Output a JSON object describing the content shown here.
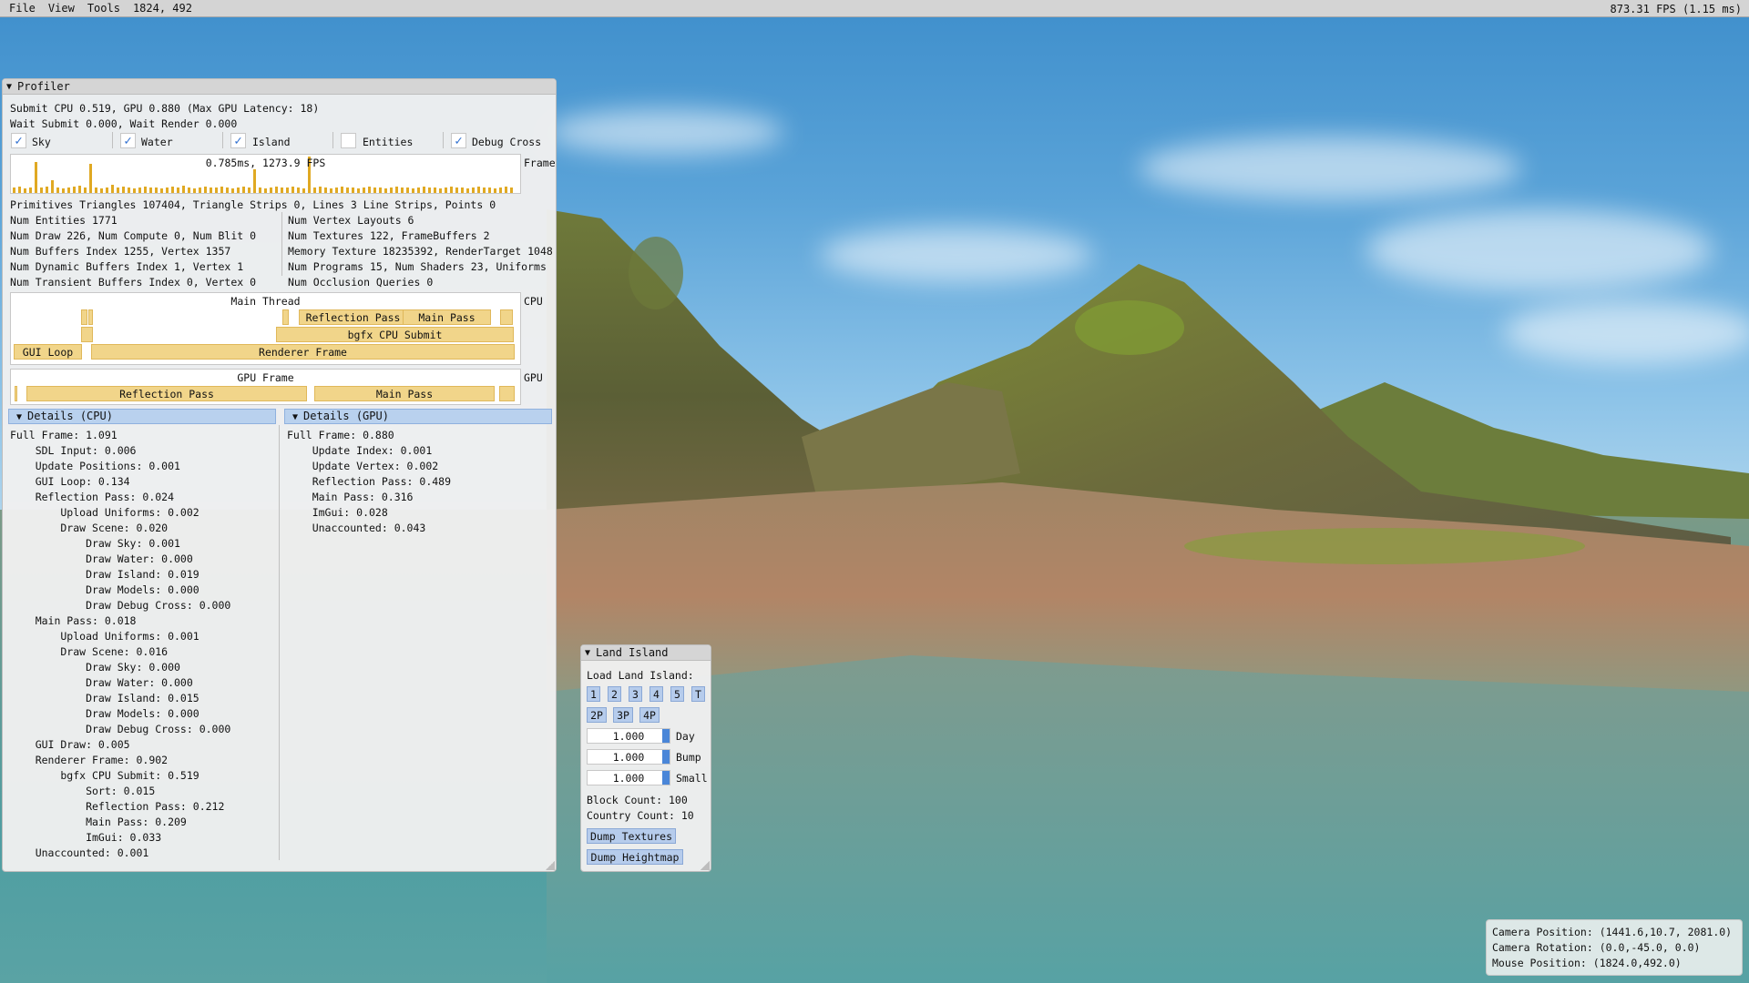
{
  "menubar": {
    "items": [
      "File",
      "View",
      "Tools"
    ],
    "mouse_readout": "1824, 492",
    "fps": "873.31 FPS (1.15 ms)"
  },
  "profiler": {
    "title": "Profiler",
    "submit_line": "Submit CPU 0.519, GPU 0.880 (Max GPU Latency: 18)",
    "wait_line": "Wait Submit 0.000, Wait Render 0.000",
    "toggles": [
      {
        "label": "Sky",
        "checked": true
      },
      {
        "label": "Water",
        "checked": true
      },
      {
        "label": "Island",
        "checked": true
      },
      {
        "label": "Entities",
        "checked": false
      },
      {
        "label": "Debug Cross",
        "checked": true
      }
    ],
    "frame_plot_label": "0.785ms, 1273.9 FPS",
    "frame_side_label": "Frame",
    "primitives": "Primitives Triangles 107404, Triangle Strips 0, Lines 3 Line Strips, Points 0",
    "stats_left": [
      "Num Entities 1771",
      "Num Draw 226, Num Compute 0, Num Blit 0",
      "Num Buffers Index 1255, Vertex 1357",
      "Num Dynamic Buffers Index 1, Vertex 1",
      "Num Transient Buffers Index 0, Vertex 0"
    ],
    "stats_right": [
      "Num Vertex Layouts 6",
      "Num Textures 122, FrameBuffers 2",
      "Memory Texture 18235392, RenderTarget 1048",
      "Num Programs 15, Num Shaders 23, Uniforms",
      "Num Occlusion Queries 0"
    ],
    "cpu_timeline": {
      "title": "Main Thread",
      "side_label": "CPU",
      "reflection_pass": "Reflection Pass",
      "main_pass": "Main Pass",
      "bgfx_submit": "bgfx CPU Submit",
      "gui_loop": "GUI Loop",
      "renderer_frame": "Renderer Frame"
    },
    "gpu_timeline": {
      "title": "GPU Frame",
      "side_label": "GPU",
      "reflection_pass": "Reflection Pass",
      "main_pass": "Main Pass"
    },
    "details_cpu": {
      "header": "Details (CPU)",
      "lines": [
        "Full Frame: 1.091",
        "    SDL Input: 0.006",
        "    Update Positions: 0.001",
        "    GUI Loop: 0.134",
        "    Reflection Pass: 0.024",
        "        Upload Uniforms: 0.002",
        "        Draw Scene: 0.020",
        "            Draw Sky: 0.001",
        "            Draw Water: 0.000",
        "            Draw Island: 0.019",
        "            Draw Models: 0.000",
        "            Draw Debug Cross: 0.000",
        "    Main Pass: 0.018",
        "        Upload Uniforms: 0.001",
        "        Draw Scene: 0.016",
        "            Draw Sky: 0.000",
        "            Draw Water: 0.000",
        "            Draw Island: 0.015",
        "            Draw Models: 0.000",
        "            Draw Debug Cross: 0.000",
        "    GUI Draw: 0.005",
        "    Renderer Frame: 0.902",
        "        bgfx CPU Submit: 0.519",
        "            Sort: 0.015",
        "            Reflection Pass: 0.212",
        "            Main Pass: 0.209",
        "            ImGui: 0.033",
        "    Unaccounted: 0.001"
      ]
    },
    "details_gpu": {
      "header": "Details (GPU)",
      "lines": [
        "Full Frame: 0.880",
        "    Update Index: 0.001",
        "    Update Vertex: 0.002",
        "    Reflection Pass: 0.489",
        "    Main Pass: 0.316",
        "    ImGui: 0.028",
        "    Unaccounted: 0.043"
      ]
    }
  },
  "land_island": {
    "title": "Land Island",
    "load_label": "Load Land Island:",
    "buttons_row1": [
      "1",
      "2",
      "3",
      "4",
      "5",
      "T"
    ],
    "buttons_row2": [
      "2P",
      "3P",
      "4P"
    ],
    "sliders": [
      {
        "value": "1.000",
        "label": "Day"
      },
      {
        "value": "1.000",
        "label": "Bump"
      },
      {
        "value": "1.000",
        "label": "Small"
      }
    ],
    "block_count": "Block Count: 100",
    "country_count": "Country Count: 10",
    "dump_textures": "Dump Textures",
    "dump_heightmap": "Dump Heightmap"
  },
  "status": {
    "camera_position": "Camera Position: (1441.6,10.7, 2081.0)",
    "camera_rotation": "Camera Rotation: (0.0,-45.0, 0.0)",
    "mouse_position": "Mouse Position: (1824.0,492.0)"
  },
  "colors": {
    "header_blue": "#b9d1ee",
    "timeline_bar": "#f1d58a",
    "button_blue": "#b6ccec",
    "check_blue": "#2f6fd0"
  }
}
